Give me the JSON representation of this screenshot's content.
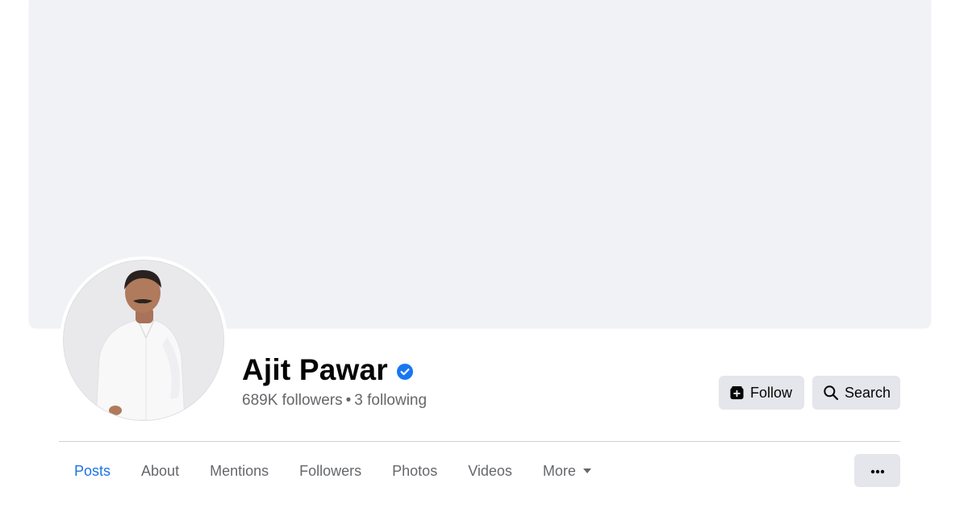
{
  "profile": {
    "name": "Ajit Pawar",
    "followers": "689K followers",
    "separator": "•",
    "following": "3 following",
    "verified": true
  },
  "actions": {
    "follow_label": "Follow",
    "search_label": "Search",
    "follow_icon": "follow-add-icon",
    "search_icon": "search-icon",
    "more_icon": "ellipsis-icon"
  },
  "tabs": [
    {
      "label": "Posts",
      "active": true
    },
    {
      "label": "About",
      "active": false
    },
    {
      "label": "Mentions",
      "active": false
    },
    {
      "label": "Followers",
      "active": false
    },
    {
      "label": "Photos",
      "active": false
    },
    {
      "label": "Videos",
      "active": false
    },
    {
      "label": "More",
      "active": false
    }
  ],
  "colors": {
    "accent": "#1b74e4",
    "verified": "#1877f2",
    "button_bg": "#e4e6eb",
    "cover_bg": "#f0f2f5",
    "secondary_text": "#65676b"
  }
}
